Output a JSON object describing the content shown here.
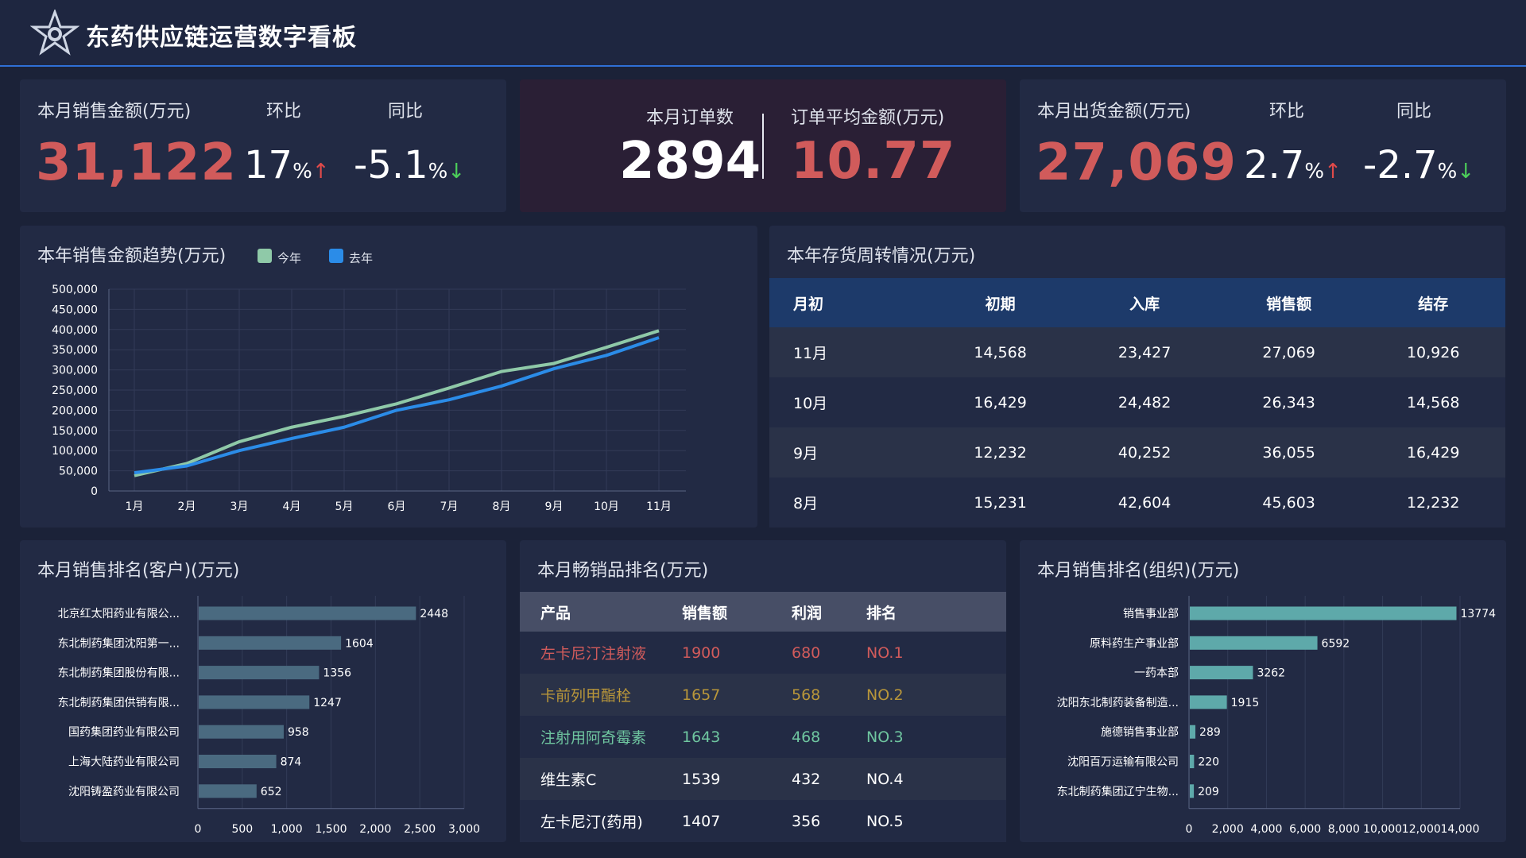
{
  "header": {
    "title": "东药供应链运营数字看板",
    "logo_icon": "star-badge-icon"
  },
  "sales_kpi": {
    "label": "本月销售金额(万元)",
    "value": "31,122",
    "mom_label": "环比",
    "mom_value": "17",
    "mom_unit": "%",
    "mom_arrow": "↑",
    "yoy_label": "同比",
    "yoy_value": "-5.1",
    "yoy_unit": "%",
    "yoy_arrow": "↓"
  },
  "order_kpi": {
    "count_label": "本月订单数",
    "count_value": "2894",
    "avg_label": "订单平均金额(万元)",
    "avg_value": "10.77"
  },
  "shipment_kpi": {
    "label": "本月出货金额(万元)",
    "value": "27,069",
    "mom_label": "环比",
    "mom_value": "2.7",
    "mom_unit": "%",
    "mom_arrow": "↑",
    "yoy_label": "同比",
    "yoy_value": "-2.7",
    "yoy_unit": "%",
    "yoy_arrow": "↓"
  },
  "trend": {
    "title": "本年销售金额趋势(万元)",
    "legend": [
      {
        "label": "今年",
        "color": "#8fc9a8"
      },
      {
        "label": "去年",
        "color": "#2b8ce8"
      }
    ]
  },
  "inventory": {
    "title": "本年存货周转情况(万元)",
    "headers": [
      "月初",
      "初期",
      "入库",
      "销售额",
      "结存"
    ],
    "rows": [
      [
        "11月",
        "14,568",
        "23,427",
        "27,069",
        "10,926"
      ],
      [
        "10月",
        "16,429",
        "24,482",
        "26,343",
        "14,568"
      ],
      [
        "9月",
        "12,232",
        "40,252",
        "36,055",
        "16,429"
      ],
      [
        "8月",
        "15,231",
        "42,604",
        "45,603",
        "12,232"
      ]
    ]
  },
  "customer_rank": {
    "title": "本月销售排名(客户)(万元)"
  },
  "product_rank": {
    "title": "本月畅销品排名(万元)",
    "headers": [
      "产品",
      "销售额",
      "利润",
      "排名"
    ],
    "rows": [
      {
        "product": "左卡尼汀注射液",
        "sales": "1900",
        "profit": "680",
        "rank": "NO.1",
        "color": "#d15b5b"
      },
      {
        "product": "卡前列甲酯栓",
        "sales": "1657",
        "profit": "568",
        "rank": "NO.2",
        "color": "#b8963a"
      },
      {
        "product": "注射用阿奇霉素",
        "sales": "1643",
        "profit": "468",
        "rank": "NO.3",
        "color": "#6fc6a0"
      },
      {
        "product": "维生素C",
        "sales": "1539",
        "profit": "432",
        "rank": "NO.4",
        "color": "#ffffff"
      },
      {
        "product": "左卡尼汀(药用)",
        "sales": "1407",
        "profit": "356",
        "rank": "NO.5",
        "color": "#ffffff"
      }
    ]
  },
  "org_rank": {
    "title": "本月销售排名(组织)(万元)"
  },
  "colors": {
    "accent_red": "#d15b5b",
    "line_this_year": "#8fc9a8",
    "line_last_year": "#2b8ce8",
    "customer_bar": "#4a6a80",
    "org_bar": "#5ea9aa"
  },
  "chart_data": [
    {
      "type": "line",
      "title": "本年销售金额趋势(万元)",
      "categories": [
        "1月",
        "2月",
        "3月",
        "4月",
        "5月",
        "6月",
        "7月",
        "8月",
        "9月",
        "10月",
        "11月"
      ],
      "series": [
        {
          "name": "今年",
          "color": "#8fc9a8",
          "values": [
            38000,
            68000,
            122000,
            158000,
            185000,
            216000,
            255000,
            296000,
            316000,
            356000,
            397000
          ]
        },
        {
          "name": "去年",
          "color": "#2b8ce8",
          "values": [
            45000,
            62000,
            100000,
            130000,
            158000,
            200000,
            226000,
            260000,
            303000,
            336000,
            380000
          ]
        }
      ],
      "yticks": [
        "0",
        "50,000",
        "100,000",
        "150,000",
        "200,000",
        "250,000",
        "300,000",
        "350,000",
        "400,000",
        "450,000",
        "500,000"
      ],
      "ylim": [
        0,
        500000
      ],
      "grid": true,
      "legend": "top"
    },
    {
      "type": "bar",
      "orientation": "horizontal",
      "title": "本月销售排名(客户)(万元)",
      "categories": [
        "北京红太阳药业有限公...",
        "东北制药集团沈阳第一...",
        "东北制药集团股份有限...",
        "东北制药集团供销有限...",
        "国药集团药业有限公司",
        "上海大陆药业有限公司",
        "沈阳铸盈药业有限公司"
      ],
      "values": [
        2448,
        1604,
        1356,
        1247,
        958,
        874,
        652
      ],
      "xticks": [
        "0",
        "500",
        "1,000",
        "1,500",
        "2,000",
        "2,500",
        "3,000"
      ],
      "xlim": [
        0,
        3000
      ],
      "color": "#4a6a80"
    },
    {
      "type": "bar",
      "orientation": "horizontal",
      "title": "本月销售排名(组织)(万元)",
      "categories": [
        "销售事业部",
        "原料药生产事业部",
        "一药本部",
        "沈阳东北制药装备制造...",
        "施德销售事业部",
        "沈阳百万运输有限公司",
        "东北制药集团辽宁生物..."
      ],
      "values": [
        13774,
        6592,
        3262,
        1915,
        289,
        220,
        209
      ],
      "xticks": [
        "0",
        "2,000",
        "4,000",
        "6,000",
        "8,000",
        "10,000",
        "12,000",
        "14,000"
      ],
      "xlim": [
        0,
        14000
      ],
      "color": "#5ea9aa"
    }
  ]
}
